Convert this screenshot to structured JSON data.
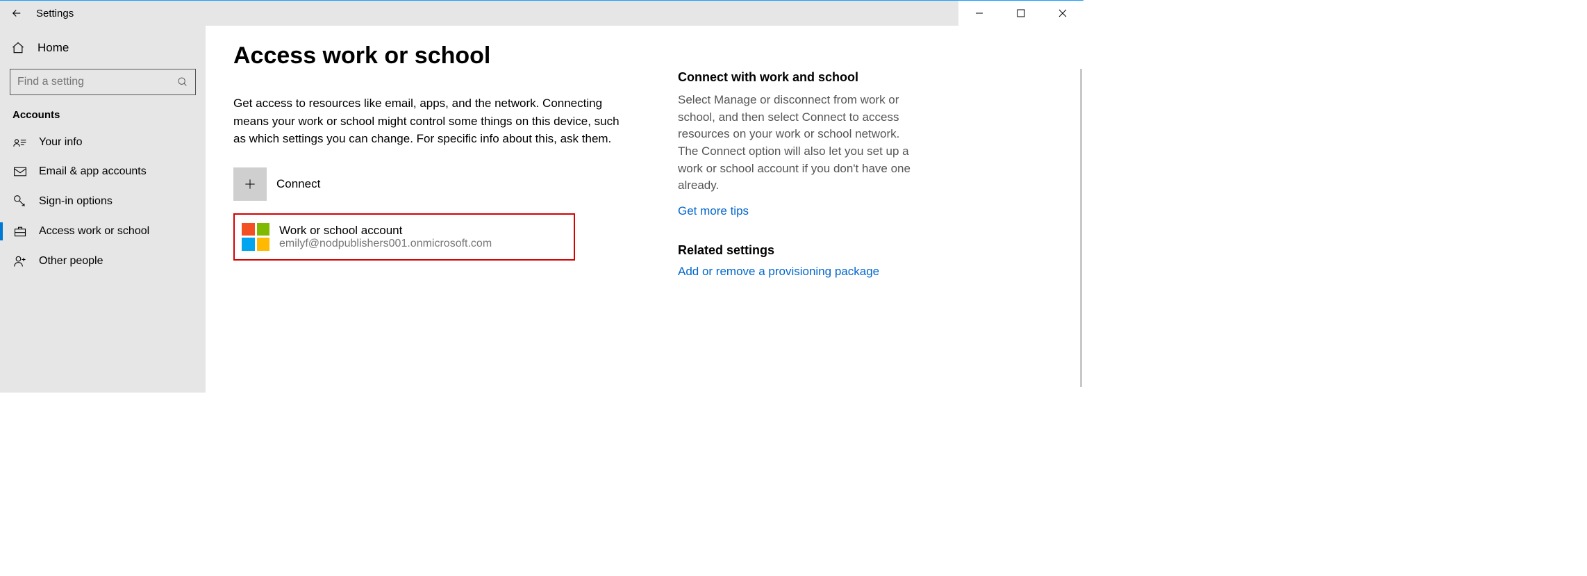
{
  "window": {
    "title": "Settings"
  },
  "sidebar": {
    "home_label": "Home",
    "search_placeholder": "Find a setting",
    "section_label": "Accounts",
    "items": [
      {
        "label": "Your info"
      },
      {
        "label": "Email & app accounts"
      },
      {
        "label": "Sign-in options"
      },
      {
        "label": "Access work or school"
      },
      {
        "label": "Other people"
      }
    ]
  },
  "main": {
    "title": "Access work or school",
    "description": "Get access to resources like email, apps, and the network. Connecting means your work or school might control some things on this device, such as which settings you can change. For specific info about this, ask them.",
    "connect_label": "Connect",
    "account": {
      "title": "Work or school account",
      "email": "emilyf@nodpublishers001.onmicrosoft.com"
    }
  },
  "aside": {
    "section1_title": "Connect with work and school",
    "section1_body": "Select Manage or disconnect from work or school, and then select Connect to access resources on your work or school network. The Connect option will also let you set up a work or school account if you don't have one already.",
    "tips_link": "Get more tips",
    "section2_title": "Related settings",
    "section2_link": "Add or remove a provisioning package"
  }
}
